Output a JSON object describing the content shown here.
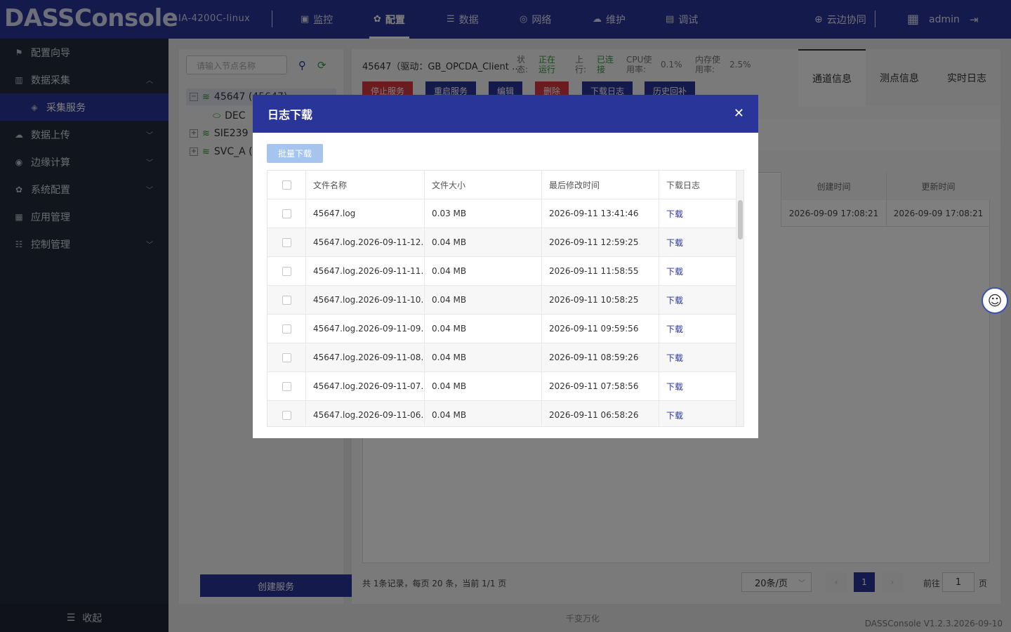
{
  "header": {
    "logo": "DASSConsole",
    "host": "IA-4200C-linux",
    "nav": [
      {
        "label": "监控",
        "icon": "monitor-icon"
      },
      {
        "label": "配置",
        "icon": "config-icon",
        "active": true
      },
      {
        "label": "数据",
        "icon": "database-icon"
      },
      {
        "label": "网络",
        "icon": "network-icon"
      },
      {
        "label": "维护",
        "icon": "maintain-icon"
      },
      {
        "label": "调试",
        "icon": "debug-icon"
      }
    ],
    "cloud": "云边协同",
    "user": "admin"
  },
  "sidebar": {
    "items": [
      {
        "label": "配置向导"
      },
      {
        "label": "数据采集"
      },
      {
        "label": "采集服务"
      },
      {
        "label": "数据上传"
      },
      {
        "label": "边缘计算"
      },
      {
        "label": "系统配置"
      },
      {
        "label": "应用管理"
      },
      {
        "label": "控制管理"
      }
    ],
    "collapse": "收起"
  },
  "tree": {
    "search_placeholder": "请输入节点名称",
    "nodes": [
      "45647 (45647)",
      "DEC",
      "SIE239",
      "SVC_A ("
    ]
  },
  "service": {
    "title": "45647（驱动：GB_OPCDA_Client …",
    "state_label": "状态:",
    "state_value": "正在运行",
    "up_label": "上行:",
    "up_value": "已连接",
    "cpu_label": "CPU使用率:",
    "cpu_value": "0.1%",
    "mem_label": "内存使用率:",
    "mem_value": "2.5%",
    "buttons": [
      "停止服务",
      "重启服务",
      "编辑",
      "删除",
      "下载日志",
      "历史回补"
    ],
    "tabs": [
      "通道信息",
      "测点信息",
      "实时日志"
    ],
    "create_button": "创建服务"
  },
  "bg_table": {
    "headers": [
      "创建时间",
      "更新时间"
    ],
    "row": [
      "2026-09-09 17:08:21",
      "2026-09-09 17:08:21"
    ]
  },
  "pager": {
    "summary": "共 1条记录，每页 20 条，当前 1/1 页",
    "page_size": "20条/页",
    "current_page": "1",
    "goto_label": "前往",
    "goto_value": "1",
    "page_suffix": "页"
  },
  "footer": {
    "brand": "千变万化",
    "version": "DASSConsole V1.2.3.2026-09-10"
  },
  "modal": {
    "title": "日志下载",
    "batch_button": "批量下载",
    "columns": [
      "文件名称",
      "文件大小",
      "最后修改时间",
      "下载日志"
    ],
    "rows": [
      {
        "name": "45647.log",
        "size": "0.03 MB",
        "time": "2026-09-11 13:41:46",
        "action": "下载"
      },
      {
        "name": "45647.log.2026-09-11-12…",
        "size": "0.04 MB",
        "time": "2026-09-11 12:59:25",
        "action": "下载"
      },
      {
        "name": "45647.log.2026-09-11-11…",
        "size": "0.04 MB",
        "time": "2026-09-11 11:58:55",
        "action": "下载"
      },
      {
        "name": "45647.log.2026-09-11-10…",
        "size": "0.04 MB",
        "time": "2026-09-11 10:58:25",
        "action": "下载"
      },
      {
        "name": "45647.log.2026-09-11-09…",
        "size": "0.04 MB",
        "time": "2026-09-11 09:59:56",
        "action": "下载"
      },
      {
        "name": "45647.log.2026-09-11-08…",
        "size": "0.04 MB",
        "time": "2026-09-11 08:59:26",
        "action": "下载"
      },
      {
        "name": "45647.log.2026-09-11-07…",
        "size": "0.04 MB",
        "time": "2026-09-11 07:58:56",
        "action": "下载"
      },
      {
        "name": "45647.log.2026-09-11-06…",
        "size": "0.04 MB",
        "time": "2026-09-11 06:58:26",
        "action": "下载"
      }
    ]
  },
  "colors": {
    "primary": "#2a3599",
    "sidebar": "#232a3c",
    "danger": "#d9363e",
    "success": "#2e9b3a"
  }
}
